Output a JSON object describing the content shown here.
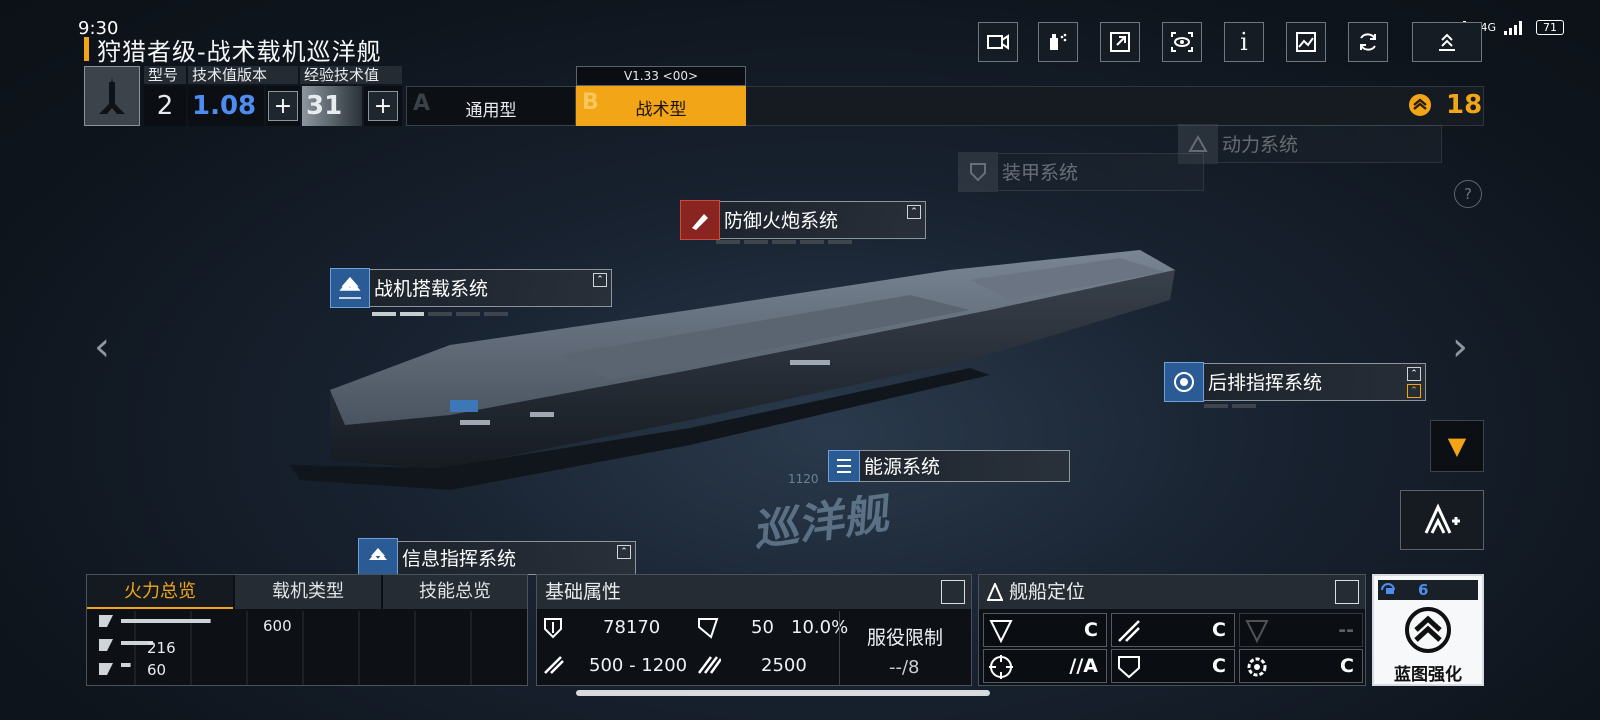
{
  "status_bar": {
    "time": "9:30",
    "signal_1": "4G",
    "signal_2": "4G",
    "battery": "71"
  },
  "title": "狩猎者级-战术载机巡洋舰",
  "toolbar": {
    "icons": [
      "camera-icon",
      "spray-icon",
      "share-icon",
      "view-icon",
      "info-icon",
      "gallery-icon",
      "refresh-icon",
      "collapse-icon"
    ],
    "info_glyph": "i"
  },
  "ship_info": {
    "model_label": "型号",
    "tech_version_label": "技术值版本",
    "exp_tech_label": "经验技术值",
    "model_value": "2",
    "tech_version_value": "1.08",
    "exp_tech_value": "31"
  },
  "type_tabs": {
    "version": "V1.33 <00>",
    "a_letter": "A",
    "a_label": "通用型",
    "b_letter": "B",
    "b_label": "战术型"
  },
  "currency": {
    "value": "18",
    "color": "#f2a516"
  },
  "systems": {
    "power": "动力系统",
    "armor": "装甲系统",
    "defense": "防御火炮系统",
    "hangar": "战机搭载系统",
    "rear_command": "后排指挥系统",
    "energy": "能源系统",
    "info_command": "信息指挥系统"
  },
  "hull_text": {
    "name": "巡洋舰",
    "code": "1120"
  },
  "help_glyph": "?",
  "nav": {
    "left": "‹",
    "right": "›",
    "dropdown": "▼"
  },
  "firepower_panel": {
    "tabs": [
      "火力总览",
      "载机类型",
      "技能总览"
    ],
    "rows": [
      {
        "value": "600",
        "fraction": 0.56
      },
      {
        "value": "216",
        "fraction": 0.2
      },
      {
        "value": "60",
        "fraction": 0.06
      }
    ]
  },
  "base_panel": {
    "title": "基础属性",
    "hp": "78170",
    "armor": "50",
    "armor_pct": "10.0%",
    "attack": "500 - 1200",
    "speed": "2500",
    "service_label": "服役限制",
    "service_value": "--/8"
  },
  "position_panel": {
    "title": "舰船定位",
    "ranks": [
      "C",
      "C",
      "--",
      "//A",
      "C",
      "C"
    ]
  },
  "blueprint": {
    "count": "6",
    "label": "蓝图强化"
  },
  "colors": {
    "accent": "#f2a516",
    "blue": "#4d8df2",
    "bg": "#161d26"
  }
}
